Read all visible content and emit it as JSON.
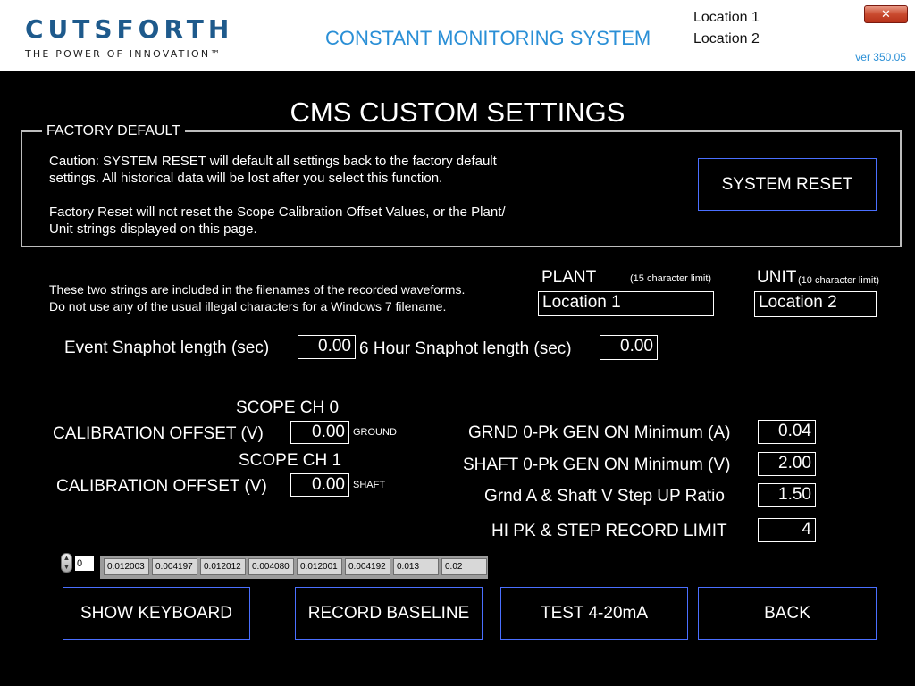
{
  "header": {
    "logo_text": "CUTSFORTH",
    "logo_tagline": "THE POWER OF INNOVATION™",
    "app_title": "CONSTANT MONITORING SYSTEM",
    "location_1": "Location 1",
    "location_2": "Location 2",
    "version": "ver 350.05",
    "close_label": "✕"
  },
  "page_title": "CMS CUSTOM SETTINGS",
  "factory_default": {
    "legend": "FACTORY DEFAULT",
    "caution_line1": "Caution: SYSTEM RESET will default all settings back to the factory default",
    "caution_line2": "settings.  All historical data will be lost after you select this function.",
    "reset_note_line1": "Factory Reset will not reset the Scope Calibration Offset Values, or the Plant/",
    "reset_note_line2": "Unit strings displayed on this page.",
    "system_reset_button": "SYSTEM RESET"
  },
  "strings": {
    "info_line1": "These two strings are included in the filenames of the recorded waveforms.",
    "info_line2": "Do not use any of the usual illegal characters for a Windows 7 filename.",
    "plant_label": "PLANT",
    "plant_limit": "(15 character limit)",
    "plant_value": "Location 1",
    "unit_label": "UNIT",
    "unit_limit": "(10 character limit)",
    "unit_value": "Location 2"
  },
  "snapshots": {
    "event_label": "Event Snaphot length (sec)",
    "event_value": "0.00",
    "six_hour_label": "6 Hour Snaphot length (sec)",
    "six_hour_value": "0.00"
  },
  "scope": {
    "ch0_title": "SCOPE CH 0",
    "ch0_label": "CALIBRATION OFFSET (V)",
    "ch0_value": "0.00",
    "ch0_unit": "GROUND",
    "ch1_title": "SCOPE CH 1",
    "ch1_label": "CALIBRATION OFFSET (V)",
    "ch1_value": "0.00",
    "ch1_unit": "SHAFT"
  },
  "limits": {
    "grnd_label": "GRND 0-Pk GEN ON Minimum (A)",
    "grnd_value": "0.04",
    "shaft_label": "SHAFT 0-Pk GEN ON Minimum (V)",
    "shaft_value": "2.00",
    "ratio_label": "Grnd A & Shaft V Step UP Ratio",
    "ratio_value": "1.50",
    "hipk_label": "HI PK & STEP RECORD LIMIT",
    "hipk_value": "4"
  },
  "baseline_array": {
    "index": "0",
    "cells": [
      "0.012003",
      "0.004197",
      "0.012012",
      "0.004080",
      "0.012001",
      "0.004192",
      "0.013",
      "0.02"
    ]
  },
  "buttons": {
    "show_keyboard": "SHOW KEYBOARD",
    "record_baseline": "RECORD BASELINE",
    "test_4_20": "TEST 4-20mA",
    "back": "BACK"
  },
  "colors": {
    "accent_blue": "#2a8fd6",
    "logo_blue": "#1e5a8c",
    "button_border": "#4a6fff",
    "background": "#000000"
  }
}
